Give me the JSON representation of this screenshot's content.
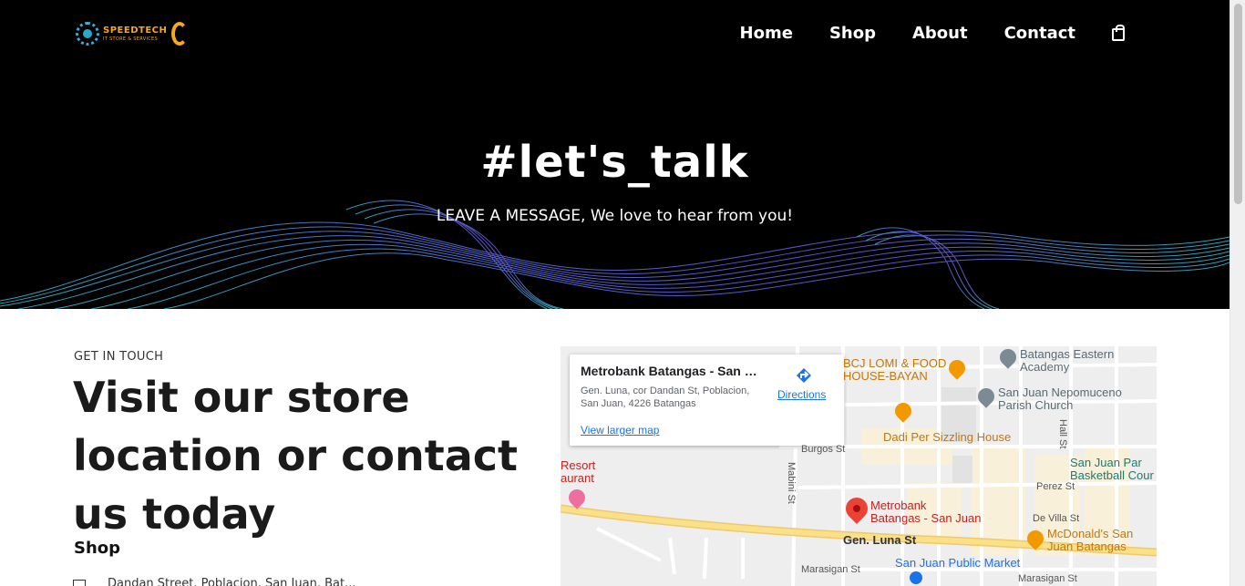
{
  "brand": {
    "name": "SPEEDTECH",
    "tagline": "IT STORE & SERVICES"
  },
  "nav": {
    "items": [
      {
        "label": "Home"
      },
      {
        "label": "Shop"
      },
      {
        "label": "About"
      },
      {
        "label": "Contact"
      }
    ],
    "cart_icon": "shopping-bag-icon"
  },
  "hero": {
    "title": "#let's_talk",
    "subtitle": "LEAVE A MESSAGE, We love to hear from you!"
  },
  "contact": {
    "kicker": "GET IN TOUCH",
    "heading": "Visit our store location or contact us today",
    "shop_label": "Shop",
    "address_partial": "Dandan Street, Poblacion, San Juan, Bat..."
  },
  "map": {
    "card": {
      "place": "Metrobank Batangas - San Ju...",
      "address": "Gen. Luna, cor Dandan St, Poblacion, San Juan, 4226 Batangas",
      "directions": "Directions",
      "larger_map": "View larger map"
    },
    "labels": {
      "bcj": "BCJ LOMI & FOOD\nHOUSE-BAYAN",
      "academy": "Batangas Eastern\nAcademy",
      "church": "San Juan Nepomuceno\nParish Church",
      "dadi": "Dadi Per Sizzling House",
      "burgos": "Burgos St",
      "park": "San Juan Par\nBasketball Cour",
      "hall": "Hall St",
      "resort": "Resort\naurant",
      "mabini": "Mabini St",
      "perez": "Perez St",
      "devilla": "De Villa St",
      "metrobank": "Metrobank\nBatangas - San Juan",
      "mcdonalds": "McDonald's San\nJuan Batangas",
      "genluna": "Gen. Luna St",
      "market": "San Juan Public Market",
      "marasigan1": "Marasigan St",
      "marasigan2": "Marasigan St"
    }
  },
  "colors": {
    "hero_bg": "#000000",
    "brand_orange": "#f6a821",
    "link_blue": "#1a73e8"
  }
}
